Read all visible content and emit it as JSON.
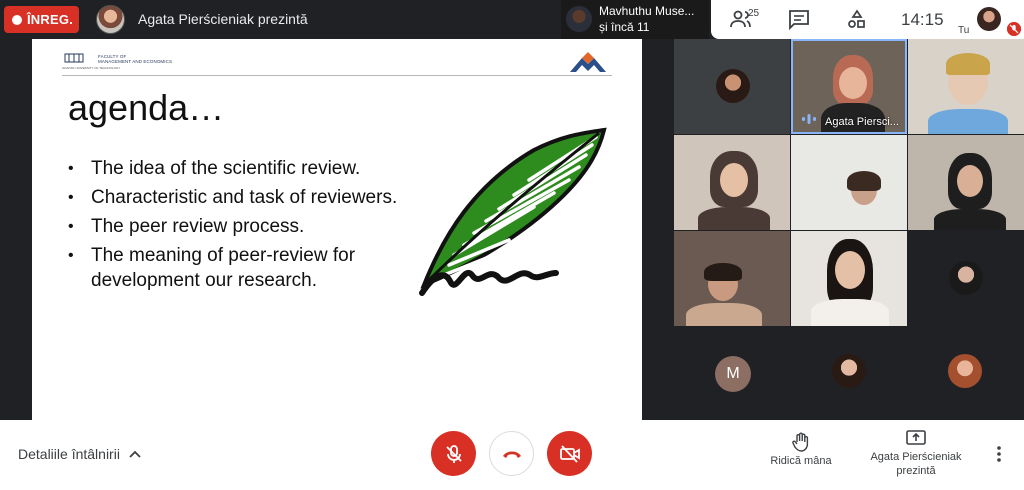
{
  "topbar": {
    "record_label": "ÎNREG.",
    "presenter_title": "Agata Pierścieniak prezintă",
    "pinned_name": "Mavhuthu Muse...",
    "pinned_more": "și încă 11",
    "people_count": "25",
    "clock": "14:15",
    "self_label": "Tu"
  },
  "slide": {
    "faculty_line1": "FACULTY OF",
    "faculty_line2": "MANAGEMENT AND ECONOMICS",
    "university": "GDANSK UNIVERSITY OF TECHNOLOGY",
    "title": "agenda…",
    "bullets": [
      "The idea of the scientific review.",
      "Characteristic and task of reviewers.",
      "The peer review process.",
      "The meaning of peer-review for development our research."
    ]
  },
  "grid": {
    "speaker_label": "Agata Piersci...",
    "m_initial": "M"
  },
  "bottombar": {
    "meeting_details": "Detaliile întâlnirii",
    "raise_hand": "Ridică mâna",
    "present_line1": "Agata Pierścieniak",
    "present_line2": "prezintă"
  },
  "colors": {
    "danger": "#d93025",
    "dark": "#202124",
    "speaking_accent": "#8ab4f8",
    "feather_green": "#2e8b1e"
  },
  "icons": [
    "record-dot-icon",
    "people-icon",
    "chat-icon",
    "activities-icon",
    "mic-off-icon",
    "end-call-icon",
    "camera-off-icon",
    "raise-hand-icon",
    "present-screen-icon",
    "more-vert-icon",
    "chevron-up-icon",
    "speaking-icon",
    "feather-icon"
  ]
}
